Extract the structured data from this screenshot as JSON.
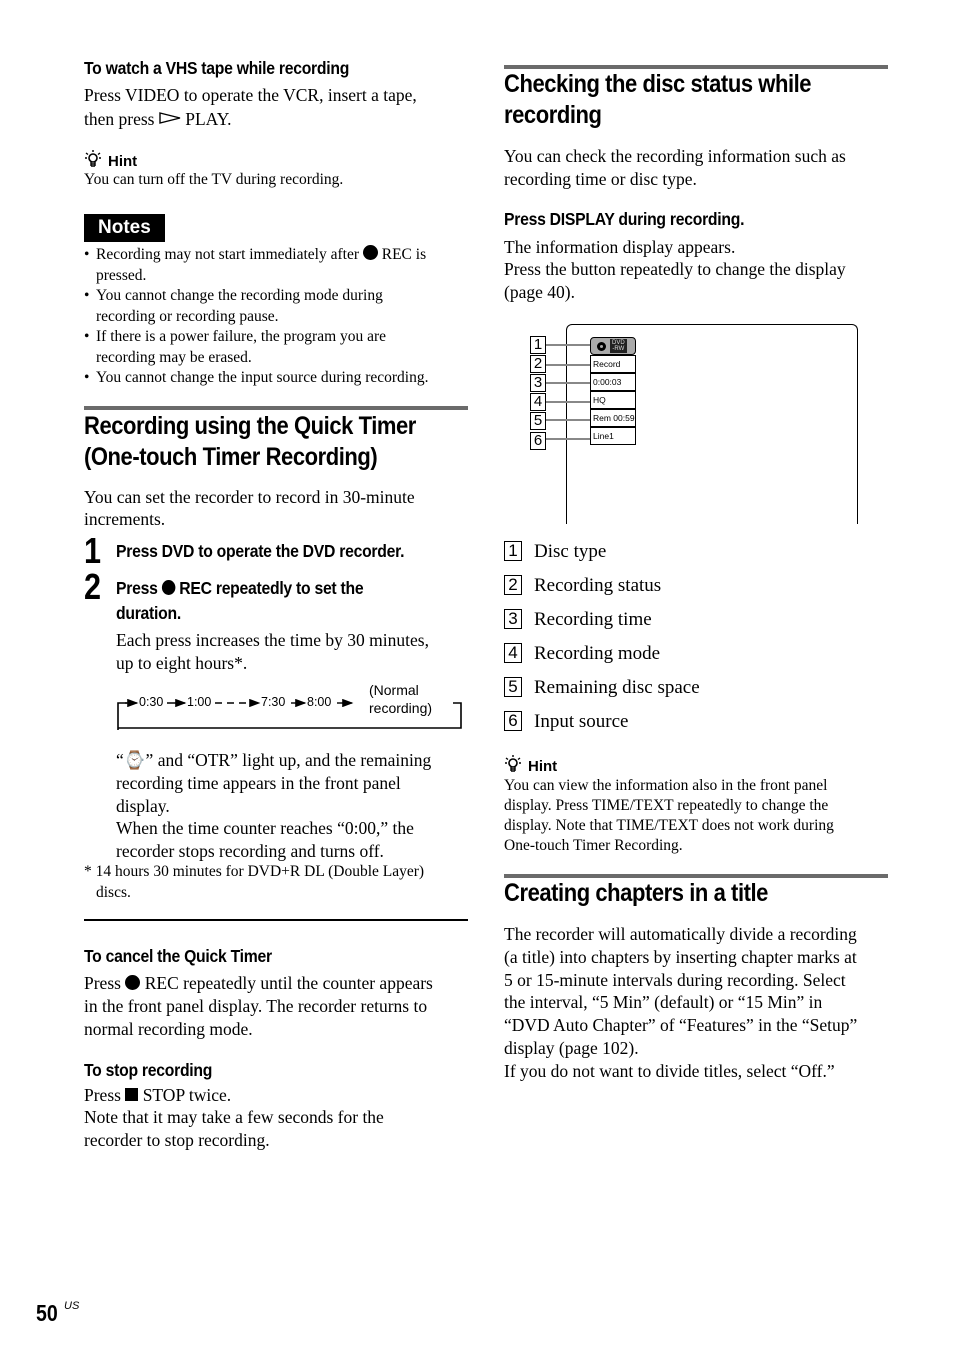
{
  "left_column": {
    "vhs": {
      "heading": "To watch a VHS tape while recording",
      "line1": "Press VIDEO to operate the VCR, insert a tape,",
      "line2_pre": "then press ",
      "line2_post": " PLAY."
    },
    "hint1": {
      "label": "Hint",
      "text": "You can turn off the TV during recording."
    },
    "notes": {
      "label": "Notes",
      "items": [
        {
          "pre": "Recording may not start immediately after ",
          "post": " REC is",
          "cont": "pressed."
        },
        {
          "pre": "You cannot change the recording mode during",
          "post": "",
          "cont": "recording or recording pause."
        },
        {
          "pre": "If there is a power failure, the program you are",
          "post": "",
          "cont": "recording may be erased."
        },
        {
          "pre": "You cannot change the input source during recording.",
          "post": "",
          "cont": ""
        }
      ]
    },
    "quick_timer": {
      "title_line1": "Recording using the Quick Timer",
      "title_line2": "(One-touch Timer Recording)",
      "intro_line1": "You can set the recorder to record in 30-minute",
      "intro_line2": "increments.",
      "step1": {
        "num": "1",
        "text": "Press DVD to operate the DVD recorder."
      },
      "step2": {
        "num": "2",
        "text_pre": "Press ",
        "text_post": " REC repeatedly to set the",
        "text_line2": "duration.",
        "body_line1": "Each press increases the time by 30 minutes,",
        "body_line2": "up to eight hours*."
      },
      "flow": {
        "steps": [
          "0:30",
          "1:00",
          "7:30",
          "8:00"
        ],
        "end_line1": "(Normal",
        "end_line2": "recording)"
      },
      "after_flow": [
        "“⌚” and “OTR” light up, and the remaining",
        "recording time appears in the front panel",
        "display.",
        "When the time counter reaches “0:00,” the",
        "recorder stops recording and turns off."
      ],
      "footnote_line1": "* 14 hours 30 minutes for DVD+R DL (Double Layer)",
      "footnote_line2": "discs."
    },
    "cancel": {
      "heading": "To cancel the Quick Timer",
      "line1_pre": "Press ",
      "line1_post": " REC repeatedly until the counter appears",
      "line2": "in the front panel display. The recorder returns to",
      "line3": "normal recording mode."
    },
    "stop": {
      "heading": "To stop recording",
      "line1_pre": "Press ",
      "line1_post": " STOP twice.",
      "line2": "Note that it may take a few seconds for the",
      "line3": "recorder to stop recording."
    }
  },
  "right_column": {
    "disc_status": {
      "title_line1": "Checking the disc status while",
      "title_line2": "recording",
      "intro_line1": "You can check the recording information such as",
      "intro_line2": "recording time or disc type.",
      "step_heading": "Press DISPLAY during recording.",
      "body_line1": "The information display appears.",
      "body_line2": "Press the button repeatedly to change the display",
      "body_line3": "(page 40)."
    },
    "osd": {
      "disc_badge_top": "DVD",
      "disc_badge_bottom": "-RW",
      "cells": [
        "Record",
        "0:00:03",
        "HQ",
        "Rem 00:59",
        "Line1"
      ],
      "callouts": [
        "1",
        "2",
        "3",
        "4",
        "5",
        "6"
      ]
    },
    "legend": [
      {
        "num": "1",
        "label": "Disc type"
      },
      {
        "num": "2",
        "label": "Recording status"
      },
      {
        "num": "3",
        "label": "Recording time"
      },
      {
        "num": "4",
        "label": "Recording mode"
      },
      {
        "num": "5",
        "label": "Remaining disc space"
      },
      {
        "num": "6",
        "label": "Input source"
      }
    ],
    "hint2": {
      "label": "Hint",
      "lines": [
        "You can view the information also in the front panel",
        "display. Press TIME/TEXT repeatedly to change the",
        "display. Note that TIME/TEXT does not work during",
        "One-touch Timer Recording."
      ]
    },
    "chapters": {
      "title": "Creating chapters in a title",
      "lines": [
        "The recorder will automatically divide a recording",
        "(a title) into chapters by inserting chapter marks at",
        "5 or 15-minute intervals during recording. Select",
        "the interval, “5 Min” (default) or “15 Min” in",
        "“DVD Auto Chapter” of “Features” in the “Setup”",
        "display (page 102).",
        "If you do not want to divide titles, select “Off.”"
      ]
    }
  },
  "footer": {
    "page_number": "50",
    "region": "US"
  }
}
